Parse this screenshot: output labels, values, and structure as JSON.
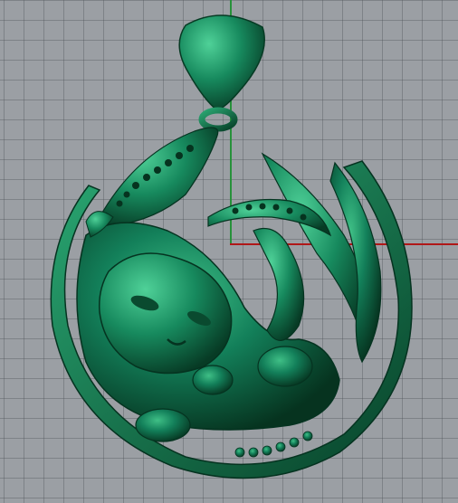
{
  "viewport": {
    "background_color": "#9b9fa4",
    "grid_color": "#5a6066",
    "x_axis_color": "#b01818",
    "y_axis_color": "#27913a"
  },
  "model": {
    "subject": "cat-pendant",
    "material_color": "#137a4e",
    "highlight_color": "#3fbf86",
    "shadow_color": "#06331f"
  }
}
